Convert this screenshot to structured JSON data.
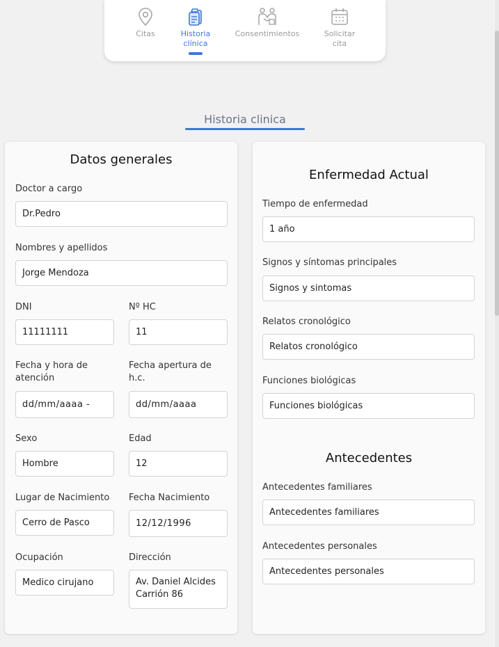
{
  "nav": {
    "items": [
      {
        "label": "Citas",
        "icon": "location-pin-icon",
        "active": false
      },
      {
        "label": "Historia clínica",
        "icon": "clipboard-icon",
        "active": true
      },
      {
        "label": "Consentimientos",
        "icon": "handshake-icon",
        "active": false
      },
      {
        "label": "Solicitar cita",
        "icon": "calendar-icon",
        "active": false
      }
    ]
  },
  "page": {
    "title": "Historia clinica"
  },
  "general": {
    "title": "Datos generales",
    "doctor_label": "Doctor a cargo",
    "doctor_value": "Dr.Pedro",
    "name_label": "Nombres y apellidos",
    "name_value": "Jorge Mendoza",
    "dni_label": "DNI",
    "dni_value": "11111111",
    "hc_label": "Nº HC",
    "hc_value": "11",
    "fecha_hora_label": "Fecha y hora de atención",
    "fecha_hora_value": "dd/mm/aaaa  -",
    "fecha_apertura_label": "Fecha apertura de h.c.",
    "fecha_apertura_value": "dd/mm/aaaa",
    "sexo_label": "Sexo",
    "sexo_value": "Hombre",
    "edad_label": "Edad",
    "edad_value": "12",
    "lugar_label": "Lugar de Nacimiento",
    "lugar_value": "Cerro de Pasco",
    "fecha_nac_label": "Fecha Nacimiento",
    "fecha_nac_value": "12/12/1996",
    "ocupacion_label": "Ocupación",
    "ocupacion_value": "Medico cirujano",
    "direccion_label": "Dirección",
    "direccion_value": "Av. Daniel Alcides Carrión 86"
  },
  "enfermedad": {
    "title": "Enfermedad Actual",
    "tiempo_label": "Tiempo de enfermedad",
    "tiempo_value": "1 año",
    "signos_label": "Signos y síntomas principales",
    "signos_value": "Signos y sintomas",
    "relatos_label": "Relatos cronológico",
    "relatos_value": "Relatos cronológico",
    "funciones_label": "Funciones biológicas",
    "funciones_value": "Funciones biológicas"
  },
  "antecedentes": {
    "title": "Antecedentes",
    "familiares_label": "Antecedentes familiares",
    "familiares_value": "Antecedentes familiares",
    "personales_label": "Antecedentes personales",
    "personales_value": "Antecedentes personales"
  },
  "colors": {
    "accent": "#3f76d8",
    "muted": "#9a9a9a"
  }
}
